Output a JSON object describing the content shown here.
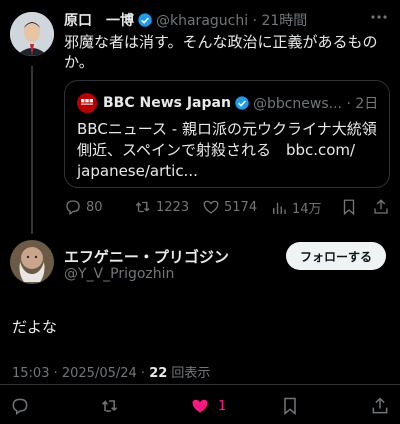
{
  "tweet": {
    "author_name": "原口　一博",
    "handle_time": "@kharaguchi · 21時間",
    "text_line1": "邪魔な者は消す。そんな政治に正義があるもの",
    "text_line2": "か。",
    "quote": {
      "source_name": "BBC News Japan",
      "source_meta": "@bbcnews... · 2日",
      "line1": "BBCニュース - 親ロ派の元ウクライナ大統領",
      "line2": "側近、スペインで射殺される　bbc.com/",
      "line3": "japanese/artic..."
    },
    "replies": "80",
    "retweets": "1223",
    "likes": "5174",
    "views": "14万"
  },
  "reply": {
    "author_name": "エフゲニー・プリゴジン",
    "handle": "@Y_V_Prigozhin",
    "follow_label": "フォローする",
    "text": "だよな",
    "timestamp": "15:03 · 2025/05/24 · ",
    "view_count": "22",
    "view_label": " 回表示",
    "like_count": "1"
  },
  "colors": {
    "accent_blue": "#1d9bf0",
    "like_pink": "#f91880",
    "bbc_red": "#b80000"
  },
  "icons": [
    "more-icon",
    "verified-icon",
    "reply-icon",
    "retweet-icon",
    "like-icon",
    "views-icon",
    "bookmark-icon",
    "share-icon"
  ]
}
